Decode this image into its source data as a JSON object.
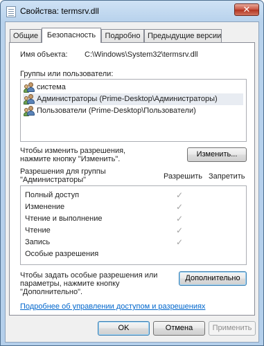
{
  "window": {
    "title": "Свойства: termsrv.dll",
    "close_glyph": "✕"
  },
  "tabs": [
    {
      "label": "Общие"
    },
    {
      "label": "Безопасность"
    },
    {
      "label": "Подробно"
    },
    {
      "label": "Предыдущие версии"
    }
  ],
  "object": {
    "label": "Имя объекта:",
    "value": "C:\\Windows\\System32\\termsrv.dll"
  },
  "groups": {
    "label": "Группы или пользователи:",
    "items": [
      {
        "label": "система",
        "icon": "users-icon"
      },
      {
        "label": "Администраторы (Prime-Desktop\\Администраторы)",
        "icon": "users-icon"
      },
      {
        "label": "Пользователи (Prime-Desktop\\Пользователи)",
        "icon": "users-icon"
      }
    ]
  },
  "change": {
    "hint_line1": "Чтобы изменить разрешения,",
    "hint_line2": "нажмите кнопку \"Изменить\".",
    "button": "Изменить..."
  },
  "permissions": {
    "title_line1": "Разрешения для группы",
    "title_line2": "\"Администраторы\"",
    "col_allow": "Разрешить",
    "col_deny": "Запретить",
    "check_glyph": "✓",
    "rows": [
      {
        "name": "Полный доступ",
        "allow": true
      },
      {
        "name": "Изменение",
        "allow": true
      },
      {
        "name": "Чтение и выполнение",
        "allow": true
      },
      {
        "name": "Чтение",
        "allow": true
      },
      {
        "name": "Запись",
        "allow": true
      },
      {
        "name": "Особые разрешения",
        "allow": false
      }
    ]
  },
  "advanced": {
    "hint_line1": "Чтобы задать особые разрешения или",
    "hint_line2": "параметры, нажмите кнопку",
    "hint_line3": "\"Дополнительно\".",
    "button": "Дополнительно"
  },
  "help_link": "Подробнее об управлении доступом и разрешениях",
  "footer": {
    "ok": "OK",
    "cancel": "Отмена",
    "apply": "Применить"
  }
}
